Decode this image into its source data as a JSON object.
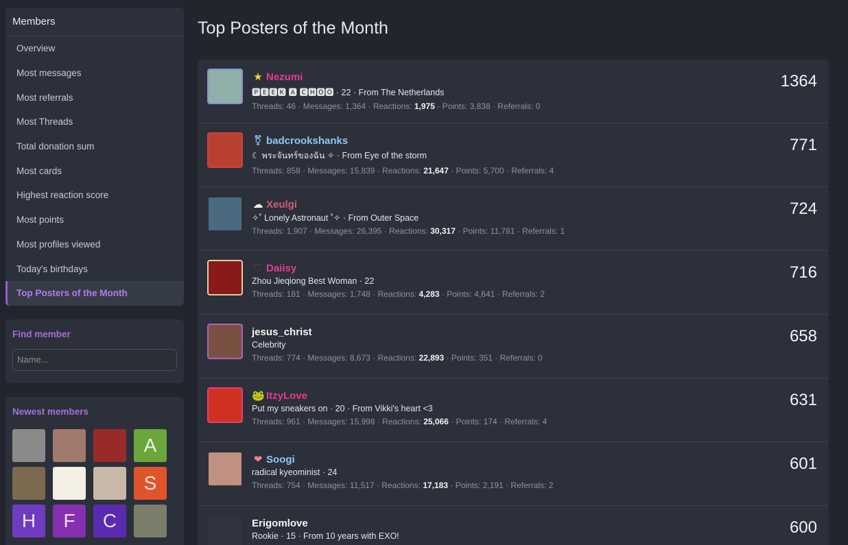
{
  "sidebar": {
    "members_heading": "Members",
    "nav": [
      {
        "label": "Overview"
      },
      {
        "label": "Most messages"
      },
      {
        "label": "Most referrals"
      },
      {
        "label": "Most Threads"
      },
      {
        "label": "Total donation sum"
      },
      {
        "label": "Most cards"
      },
      {
        "label": "Highest reaction score"
      },
      {
        "label": "Most points"
      },
      {
        "label": "Most profiles viewed"
      },
      {
        "label": "Today's birthdays"
      },
      {
        "label": "Top Posters of the Month",
        "active": true
      }
    ],
    "find_member": {
      "title": "Find member",
      "placeholder": "Name..."
    },
    "newest": {
      "title": "Newest members",
      "members": [
        {
          "letter": "",
          "color": "#8a8a8a"
        },
        {
          "letter": "",
          "color": "#a07a6c"
        },
        {
          "letter": "",
          "color": "#9a2a2a"
        },
        {
          "letter": "A",
          "color": "#6aa63a"
        },
        {
          "letter": "",
          "color": "#7a6a50"
        },
        {
          "letter": "",
          "color": "#f5f0e6"
        },
        {
          "letter": "",
          "color": "#c8b8a8"
        },
        {
          "letter": "S",
          "color": "#e0542a"
        },
        {
          "letter": "H",
          "color": "#6f3cc0"
        },
        {
          "letter": "F",
          "color": "#8530b0"
        },
        {
          "letter": "C",
          "color": "#5a2ab0"
        },
        {
          "letter": "",
          "color": "#7a7e6a"
        }
      ]
    }
  },
  "main": {
    "title": "Top Posters of the Month",
    "rows": [
      {
        "name": "Nezumi",
        "icon": "star-icon",
        "glyph": "★",
        "icon_color": "#f7d33a",
        "name_color": "#e8398f",
        "avatar_color": "#8fb0a8",
        "avatar_border": "#8a8fd8",
        "title": "🅿🅴🅴🅺 🅰 🅲🅷🅾🅾 · 22 · From The Netherlands",
        "threads": "46",
        "messages": "1,364",
        "reactions": "1,975",
        "points": "3,838",
        "referrals": "0",
        "count": "1364"
      },
      {
        "name": "badcrookshanks",
        "icon": "gender-icon",
        "glyph": "⚧",
        "icon_color": "#8ec8f0",
        "name_color": "#8ec8f0",
        "avatar_color": "#b84030",
        "avatar_border": "#d04040",
        "title": "☾ พระจันทร์ของฉัน ✧ · From Eye of the storm",
        "threads": "858",
        "messages": "15,839",
        "reactions": "21,647",
        "points": "5,700",
        "referrals": "4",
        "count": "771"
      },
      {
        "name": "Xeulgi",
        "icon": "cloud-icon",
        "glyph": "☁",
        "icon_color": "#f2f3f5",
        "name_color": "#d25c7a",
        "avatar_color": "#4a6a80",
        "avatar_border": "#2c303a",
        "title": "✧˚ Lonely Astronaut ˚✧ · From Outer Space",
        "threads": "1,907",
        "messages": "26,395",
        "reactions": "30,317",
        "points": "11,781",
        "referrals": "1",
        "count": "724"
      },
      {
        "name": "Daiisy",
        "icon": "heart-outline-icon",
        "glyph": "♡",
        "icon_color": "#c03040",
        "name_color": "#e8398f",
        "avatar_color": "#8a1a1a",
        "avatar_border": "#e0d0a0",
        "title": "Zhou Jieqiong Best Woman · 22",
        "threads": "181",
        "messages": "1,748",
        "reactions": "4,283",
        "points": "4,641",
        "referrals": "2",
        "count": "716"
      },
      {
        "name": "jesus_christ",
        "icon": "",
        "glyph": "",
        "icon_color": "#ffffff",
        "name_color": "#f5f5f5",
        "avatar_color": "#7a5040",
        "avatar_border": "#b060c0",
        "title": "Celebrity",
        "threads": "774",
        "messages": "8,673",
        "reactions": "22,893",
        "points": "351",
        "referrals": "0",
        "count": "658"
      },
      {
        "name": "ItzyLove",
        "icon": "frog-icon",
        "glyph": "🐸",
        "icon_color": "#40c070",
        "name_color": "#e8398f",
        "avatar_color": "#d03020",
        "avatar_border": "#e04080",
        "title": "Put my sneakers on · 20 · From Vikki's heart <3",
        "threads": "961",
        "messages": "15,998",
        "reactions": "25,066",
        "points": "174",
        "referrals": "4",
        "count": "631"
      },
      {
        "name": "Soogi",
        "icon": "heart-icon",
        "glyph": "❤",
        "icon_color": "#f08090",
        "name_color": "#8ec8f0",
        "avatar_color": "#c09080",
        "avatar_border": "#2c303a",
        "title": "radical kyeominist · 24",
        "threads": "754",
        "messages": "11,517",
        "reactions": "17,183",
        "points": "2,191",
        "referrals": "2",
        "count": "601"
      },
      {
        "name": "Erigomlove",
        "icon": "",
        "glyph": "",
        "icon_color": "#ffffff",
        "name_color": "#f5f5f5",
        "avatar_color": "#303540",
        "avatar_border": "#2c303a",
        "title": "Rookie · 15 · From 10 years with EXO!",
        "threads": "",
        "messages": "",
        "reactions": "",
        "points": "",
        "referrals": "",
        "count": "600"
      }
    ],
    "stat_labels": {
      "threads": "Threads:",
      "messages": "Messages:",
      "reactions": "Reactions:",
      "points": "Points:",
      "referrals": "Referrals:"
    }
  }
}
